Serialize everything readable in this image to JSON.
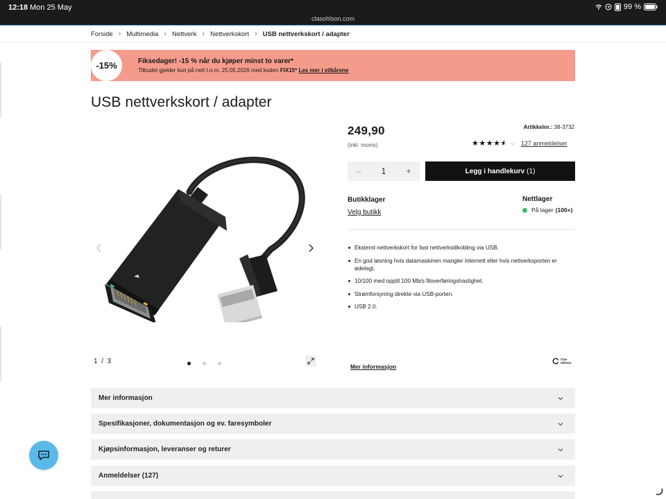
{
  "statusbar": {
    "time": "12:18",
    "date": "Mon 25 May",
    "url": "clasohlson.com",
    "battery": "99 %"
  },
  "breadcrumb": {
    "items": [
      "Forside",
      "Multimedia",
      "Nettverk",
      "Nettverkskort"
    ],
    "current": "USB nettverkskort / adapter"
  },
  "promo": {
    "badge": "-15%",
    "title": "Fiksedager! -15 % når du kjøper minst to varer*",
    "subtitle_prefix": "Tilbudet gjelder kun på nett t.o.m. 25.05.2026 med koden",
    "code": "FIX15*",
    "link": "Les mer i vilkårene",
    "color": "#f59b8b"
  },
  "product": {
    "title": "USB nettverkskort / adapter",
    "price": "249,90",
    "vat_note": "(inkl. moms)",
    "article_label": "Artikkelnr.:",
    "article_number": "38-3732",
    "rating": 4.5,
    "reviews_link": "127 anmeldelser",
    "quantity": "1",
    "add_to_cart": "Legg i handlekurv",
    "cart_count": "(1)",
    "store_heading": "Butikklager",
    "store_link": "Velg butikk",
    "online_heading": "Nettlager",
    "stock_status": "På lager",
    "stock_count": "(100+)",
    "stock_color": "#3cba6c",
    "features": [
      "Eksternt nettverkskort for fast nettverkstilkobling via USB.",
      "En god løsning hvis datamaskinen mangler Internett eller hvis nettverksporten er ødelagt.",
      "10/100 med opptil 100 Mb/s filoverføringshastighet.",
      "Strømforsyning direkte via USB-porten.",
      "USB 2.0."
    ],
    "more_info_link": "Mer informasjon",
    "brand_line1": "Clas",
    "brand_line2": "Ohlson"
  },
  "gallery": {
    "current": "1",
    "separator": "/",
    "total": "3",
    "slides": 3
  },
  "accordions": [
    "Mer informasjon",
    "Spesifikasjoner, dokumentasjon og ev. faresymboler",
    "Kjøpsinformasjon, leveranser og returer",
    "Anmeldelser (127)"
  ],
  "icons": {
    "chat": "chat-bubble-icon",
    "expand": "expand-icon",
    "chevron": "chevron-down-icon"
  }
}
